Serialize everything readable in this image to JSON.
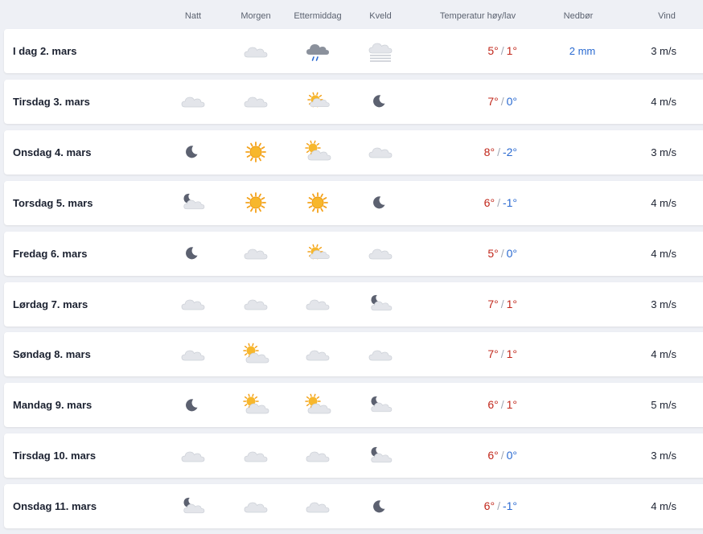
{
  "header": {
    "night": "Natt",
    "morning": "Morgen",
    "afternoon": "Ettermiddag",
    "evening": "Kveld",
    "temp": "Temperatur høy/lav",
    "precip": "Nedbør",
    "wind": "Vind"
  },
  "colors": {
    "warm_temp": "#c1271b",
    "cold_temp": "#2a6ad1",
    "precip": "#2a6ad1",
    "row_bg": "#ffffff",
    "page_bg": "#eef0f5"
  },
  "days": [
    {
      "label": "I dag 2. mars",
      "night": "",
      "morning": "cloud",
      "afternoon": "rain-cloud",
      "evening": "fog-cloud",
      "high": "5°",
      "low": "1°",
      "precip": "2 mm",
      "wind": "3 m/s"
    },
    {
      "label": "Tirsdag 3. mars",
      "night": "cloud",
      "morning": "cloud",
      "afternoon": "sun-cloud",
      "evening": "moon",
      "high": "7°",
      "low": "0°",
      "precip": "",
      "wind": "4 m/s"
    },
    {
      "label": "Onsdag 4. mars",
      "night": "moon",
      "morning": "sun",
      "afternoon": "cloud-sun",
      "evening": "cloud",
      "high": "8°",
      "low": "-2°",
      "precip": "",
      "wind": "3 m/s"
    },
    {
      "label": "Torsdag 5. mars",
      "night": "moon-cloud",
      "morning": "sun",
      "afternoon": "sun",
      "evening": "moon",
      "high": "6°",
      "low": "-1°",
      "precip": "",
      "wind": "4 m/s"
    },
    {
      "label": "Fredag 6. mars",
      "night": "moon",
      "morning": "cloud",
      "afternoon": "sun-cloud",
      "evening": "cloud",
      "high": "5°",
      "low": "0°",
      "precip": "",
      "wind": "4 m/s"
    },
    {
      "label": "Lørdag 7. mars",
      "night": "cloud",
      "morning": "cloud",
      "afternoon": "cloud",
      "evening": "moon-cloud",
      "high": "7°",
      "low": "1°",
      "precip": "",
      "wind": "3 m/s"
    },
    {
      "label": "Søndag 8. mars",
      "night": "cloud",
      "morning": "cloud-sun",
      "afternoon": "cloud",
      "evening": "cloud",
      "high": "7°",
      "low": "1°",
      "precip": "",
      "wind": "4 m/s"
    },
    {
      "label": "Mandag 9. mars",
      "night": "moon",
      "morning": "cloud-sun",
      "afternoon": "cloud-sun",
      "evening": "moon-cloud",
      "high": "6°",
      "low": "1°",
      "precip": "",
      "wind": "5 m/s"
    },
    {
      "label": "Tirsdag 10. mars",
      "night": "cloud",
      "morning": "cloud",
      "afternoon": "cloud",
      "evening": "moon-cloud",
      "high": "6°",
      "low": "0°",
      "precip": "",
      "wind": "3 m/s"
    },
    {
      "label": "Onsdag 11. mars",
      "night": "moon-cloud",
      "morning": "cloud",
      "afternoon": "cloud",
      "evening": "moon",
      "high": "6°",
      "low": "-1°",
      "precip": "",
      "wind": "4 m/s"
    }
  ]
}
